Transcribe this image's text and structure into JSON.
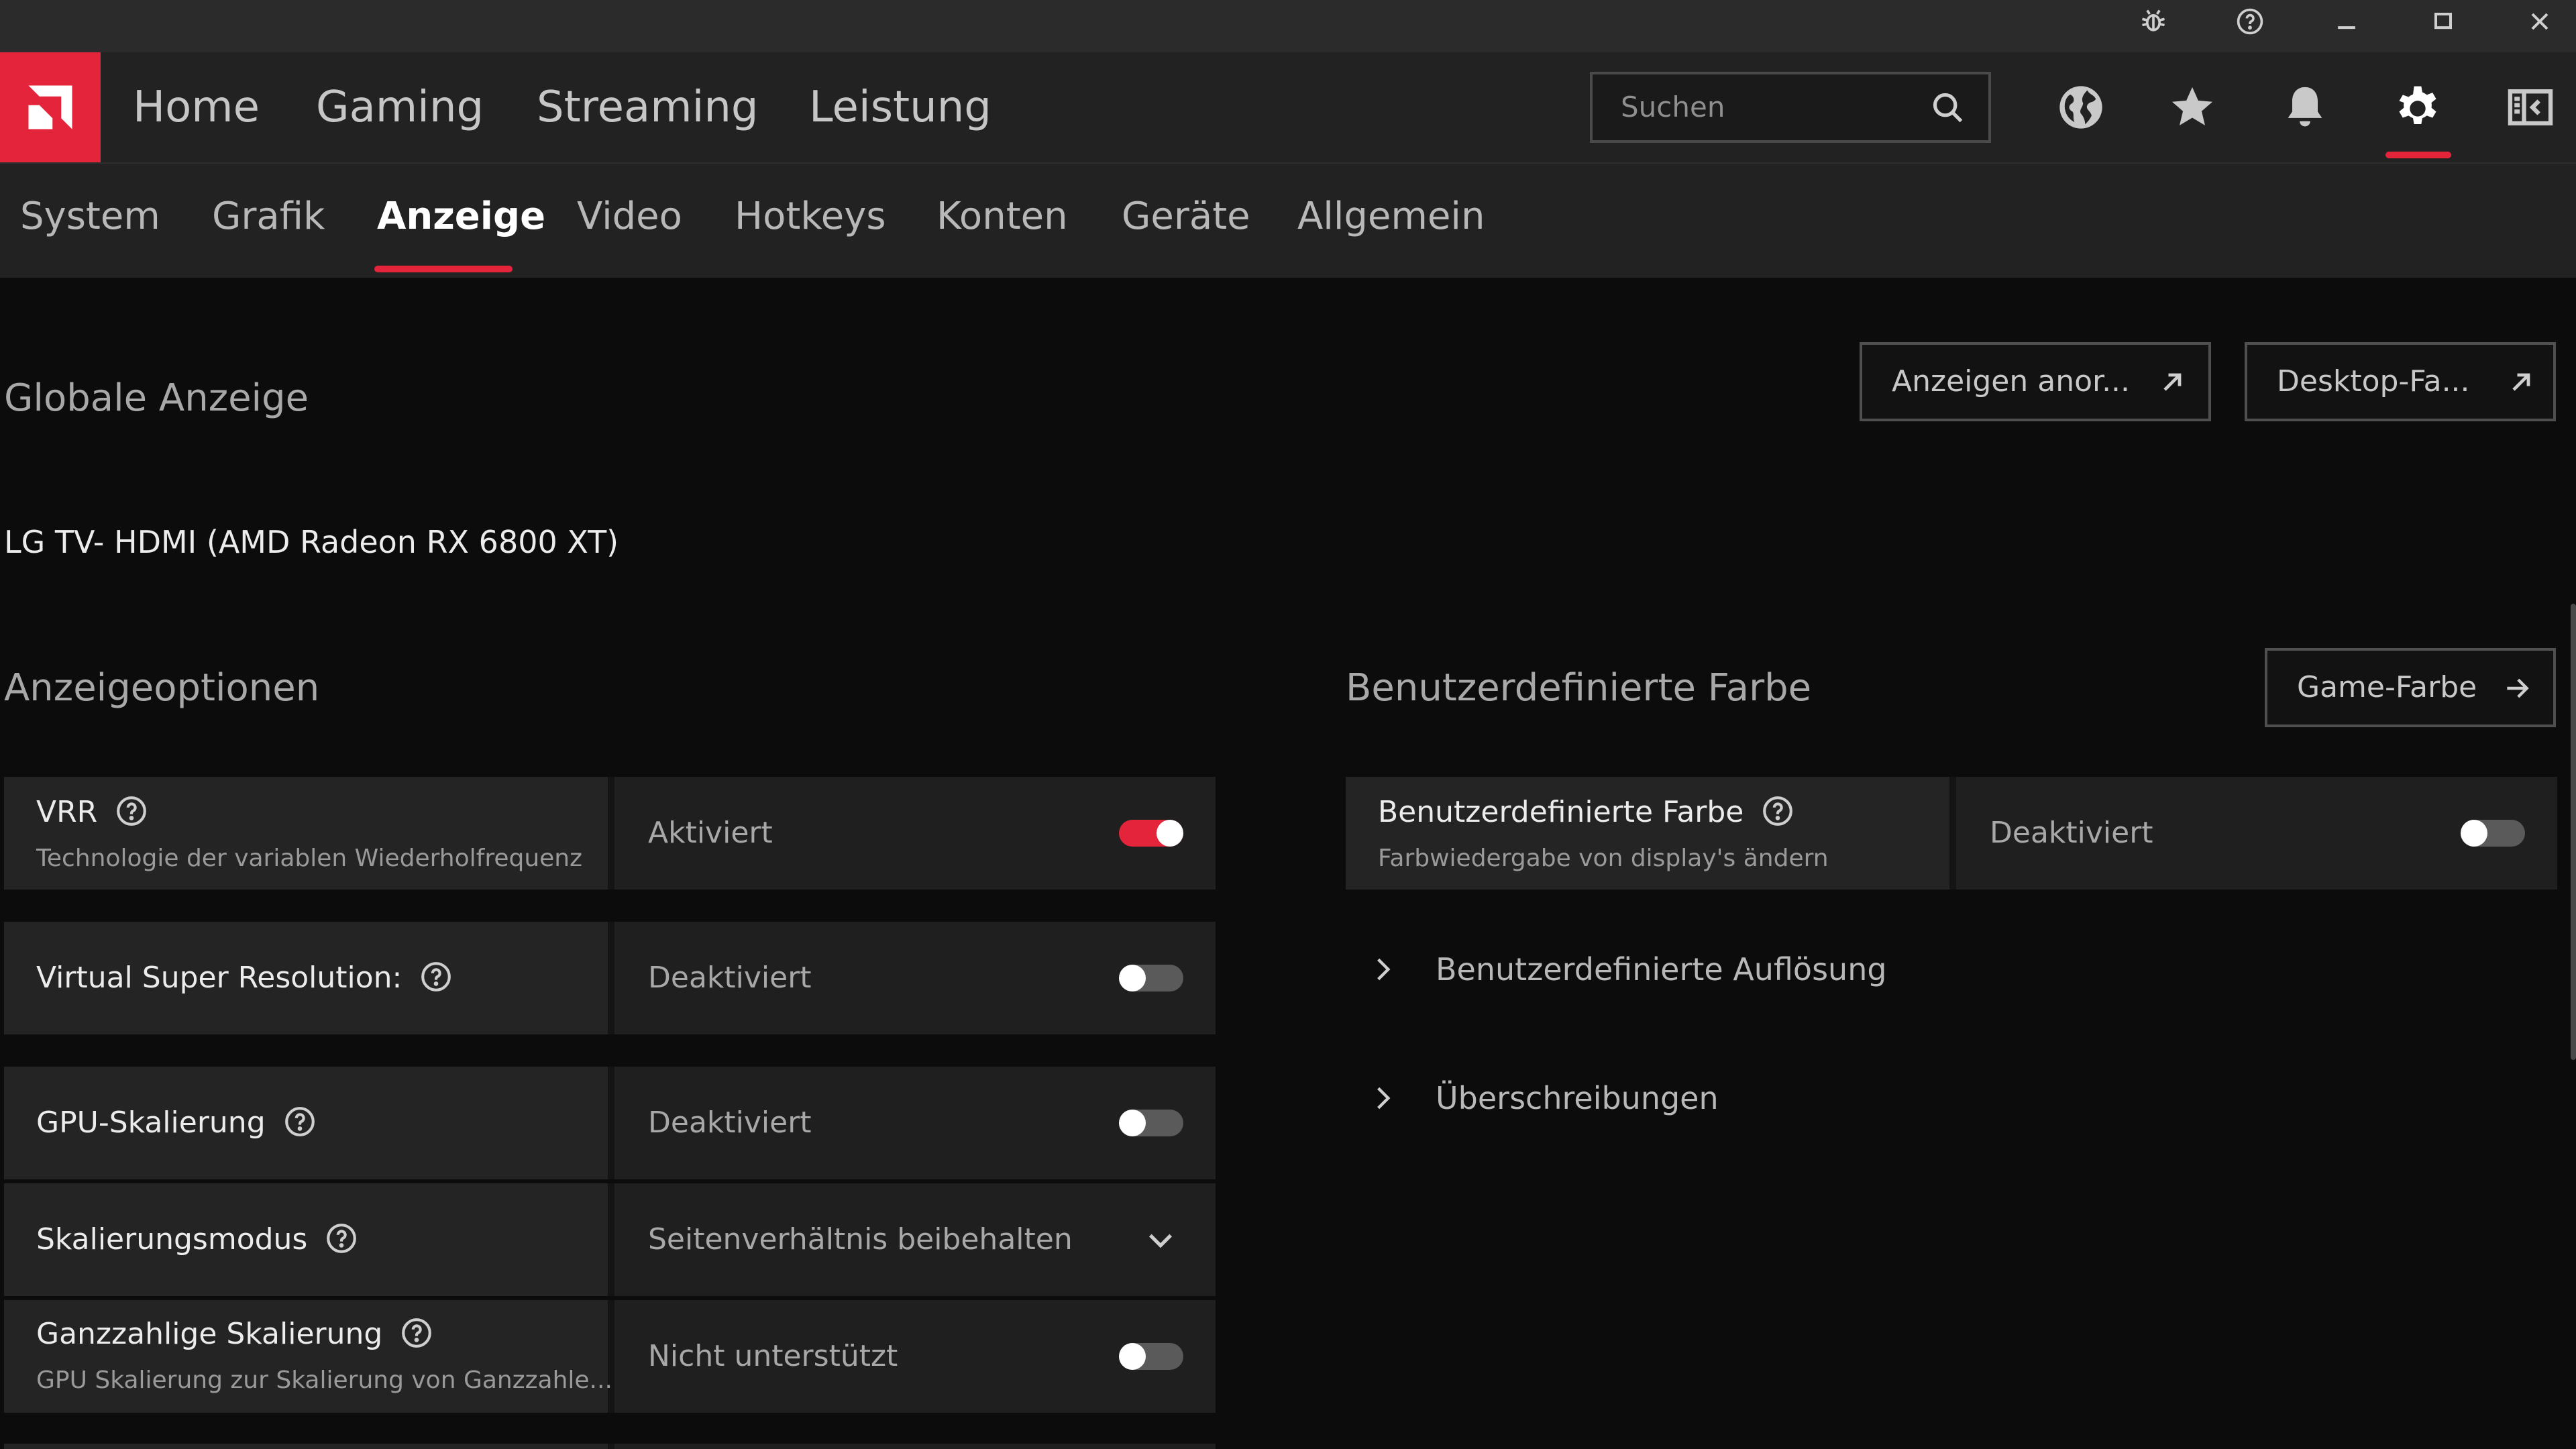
{
  "colors": {
    "accent": "#e4243b",
    "background": "#0c0c0d",
    "nav_background": "#222223"
  },
  "window_controls": {
    "icons": [
      "bug-icon",
      "help-circle-icon",
      "minimize-icon",
      "maximize-icon",
      "close-icon"
    ]
  },
  "main_nav": {
    "items": [
      "Home",
      "Gaming",
      "Streaming",
      "Leistung"
    ],
    "search_placeholder": "Suchen",
    "icons": [
      "globe-icon",
      "star-icon",
      "bell-icon",
      "gear-icon",
      "sidebar-toggle-icon"
    ],
    "active_icon": "gear-icon"
  },
  "sub_nav": {
    "items": [
      "System",
      "Grafik",
      "Anzeige",
      "Video",
      "Hotkeys",
      "Konten",
      "Geräte",
      "Allgemein"
    ],
    "active": "Anzeige"
  },
  "global": {
    "title": "Globale Anzeige",
    "display_name": "LG TV- HDMI (AMD Radeon RX 6800 XT)",
    "buttons": [
      "Anzeigen anor...",
      "Desktop-Fa..."
    ]
  },
  "display_options": {
    "title": "Anzeigeoptionen",
    "rows": [
      {
        "title": "VRR",
        "description": "Technologie der variablen Wiederholfrequenz",
        "value": "Aktiviert",
        "control": "toggle",
        "on": true
      },
      {
        "title": "Virtual Super Resolution:",
        "description": "",
        "value": "Deaktiviert",
        "control": "toggle",
        "on": false
      },
      {
        "title": "GPU-Skalierung",
        "description": "",
        "value": "Deaktiviert",
        "control": "toggle",
        "on": false
      },
      {
        "title": "Skalierungsmodus",
        "description": "",
        "value": "Seitenverhältnis beibehalten",
        "control": "dropdown"
      },
      {
        "title": "Ganzzahlige Skalierung",
        "description": "GPU Skalierung zur Skalierung von Ganzzahle...",
        "value": "Nicht unterstützt",
        "control": "toggle",
        "on": false
      }
    ]
  },
  "custom_color": {
    "title": "Benutzerdefinierte Farbe",
    "button": "Game-Farbe",
    "row": {
      "title": "Benutzerdefinierte Farbe",
      "description": "Farbwiedergabe von display's ändern",
      "value": "Deaktiviert",
      "on": false
    },
    "expanders": [
      "Benutzerdefinierte Auflösung",
      "Überschreibungen"
    ]
  }
}
